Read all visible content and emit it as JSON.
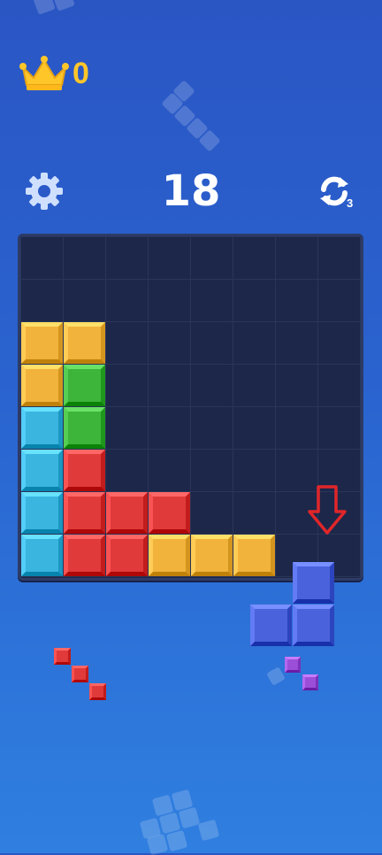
{
  "header": {
    "best_score": "0",
    "score": "18",
    "refresh_count": "3",
    "crown_icon": "crown-icon",
    "settings_icon": "gear-icon",
    "refresh_icon": "refresh-icon"
  },
  "colors": {
    "yellow": "#f2b33c",
    "green": "#3db43a",
    "cyan": "#3ab5e0",
    "red": "#e03a3a",
    "blue": "#4a62dc",
    "purple": "#9b4fd8",
    "board": "#1d2749",
    "crown": "#ffc62a",
    "arrow": "#e0262a"
  },
  "board": {
    "rows": 8,
    "cols": 8,
    "filled": [
      {
        "r": 2,
        "c": 0,
        "color": "yellow"
      },
      {
        "r": 2,
        "c": 1,
        "color": "yellow"
      },
      {
        "r": 3,
        "c": 0,
        "color": "yellow"
      },
      {
        "r": 3,
        "c": 1,
        "color": "green"
      },
      {
        "r": 4,
        "c": 0,
        "color": "cyan"
      },
      {
        "r": 4,
        "c": 1,
        "color": "green"
      },
      {
        "r": 5,
        "c": 0,
        "color": "cyan"
      },
      {
        "r": 5,
        "c": 1,
        "color": "red"
      },
      {
        "r": 6,
        "c": 0,
        "color": "cyan"
      },
      {
        "r": 6,
        "c": 1,
        "color": "red"
      },
      {
        "r": 6,
        "c": 2,
        "color": "red"
      },
      {
        "r": 6,
        "c": 3,
        "color": "red"
      },
      {
        "r": 7,
        "c": 0,
        "color": "cyan"
      },
      {
        "r": 7,
        "c": 1,
        "color": "red"
      },
      {
        "r": 7,
        "c": 2,
        "color": "red"
      },
      {
        "r": 7,
        "c": 3,
        "color": "yellow"
      },
      {
        "r": 7,
        "c": 4,
        "color": "yellow"
      },
      {
        "r": 7,
        "c": 5,
        "color": "yellow"
      }
    ]
  },
  "hint": {
    "arrow_icon": "down-arrow-icon"
  },
  "tray": {
    "pieces": [
      {
        "name": "red-diagonal-piece",
        "color": "red",
        "cells": [
          [
            0,
            0
          ],
          [
            1,
            1
          ],
          [
            2,
            2
          ]
        ]
      },
      {
        "name": "blue-l-piece",
        "color": "blue",
        "cells": [
          [
            0,
            1
          ],
          [
            1,
            0
          ],
          [
            1,
            1
          ]
        ]
      },
      {
        "name": "purple-diagonal-piece",
        "color": "purple",
        "cells": [
          [
            0,
            0
          ],
          [
            1,
            1
          ]
        ]
      }
    ]
  }
}
